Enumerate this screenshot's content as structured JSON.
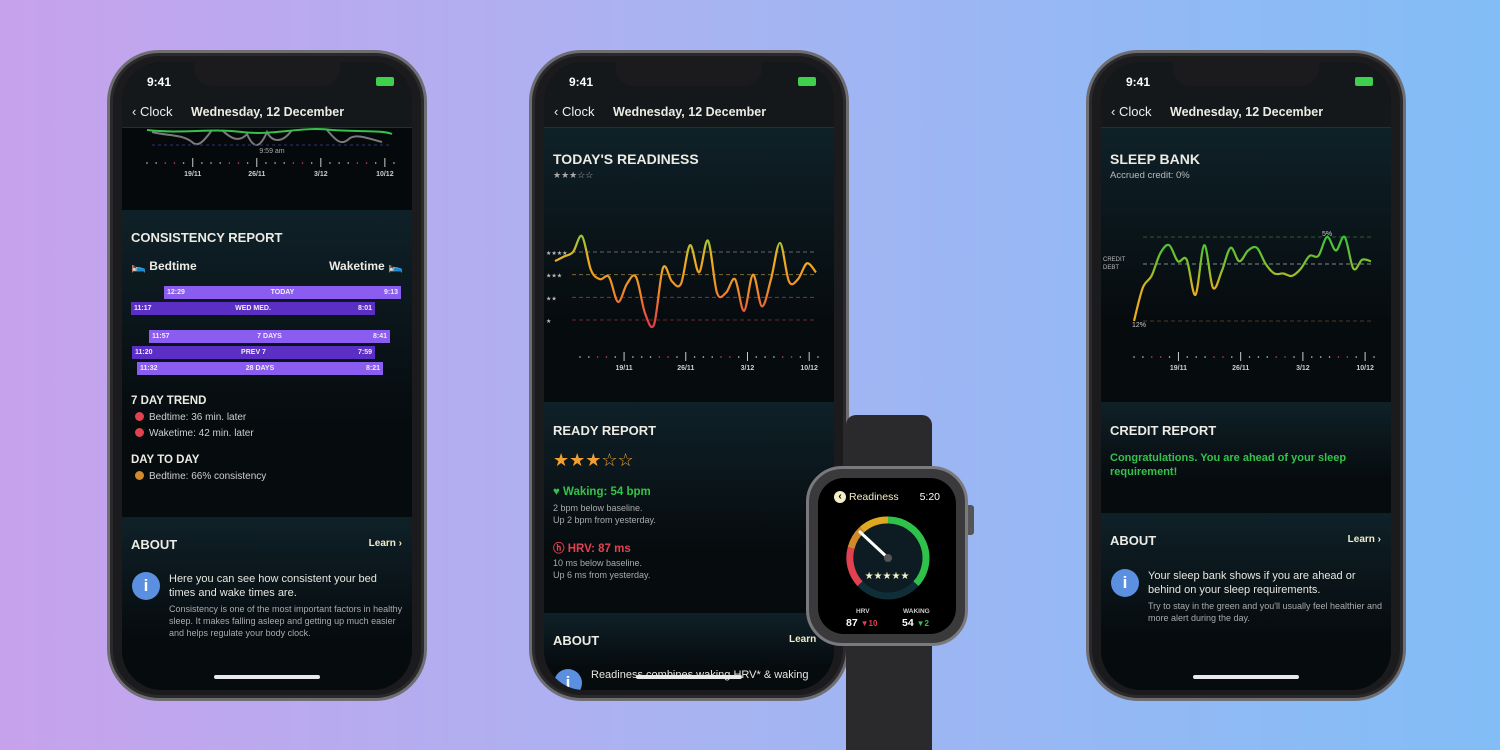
{
  "status": {
    "time": "9:41"
  },
  "nav": {
    "back": "Clock",
    "title": "Wednesday, 12 December"
  },
  "date_ticks": [
    "19/11",
    "26/11",
    "3/12",
    "10/12"
  ],
  "consistency": {
    "top_chart_label": "9:59 am",
    "title": "CONSISTENCY REPORT",
    "bedtime": "Bedtime",
    "waketime": "Waketime",
    "bars": [
      {
        "label": "TODAY",
        "start": "12:29",
        "end": "9:13",
        "color": "#8a5cf0"
      },
      {
        "label": "WED MED.",
        "start": "11:17",
        "end": "8:01",
        "color": "#5b2fc4"
      },
      {
        "label": "7 DAYS",
        "start": "11:57",
        "end": "8:41",
        "color": "#8a5cf0"
      },
      {
        "label": "PREV 7",
        "start": "11:20",
        "end": "7:59",
        "color": "#5b2fc4"
      },
      {
        "label": "28 DAYS",
        "start": "11:32",
        "end": "8:21",
        "color": "#8a5cf0"
      }
    ],
    "trend_title": "7 DAY TREND",
    "trend_items": [
      "Bedtime: 36 min. later",
      "Waketime: 42 min. later"
    ],
    "day_title": "DAY TO DAY",
    "day_items": [
      "Bedtime: 66% consistency"
    ],
    "about_title": "ABOUT",
    "learn": "Learn ›",
    "about_main": "Here you can see how consistent your bed times and wake times are.",
    "about_sub": "Consistency is one of the most important factors in healthy sleep. It makes falling asleep and getting up much easier and helps regulate your body clock."
  },
  "readiness": {
    "title": "TODAY'S READINESS",
    "stars": 3,
    "star_text": "★★★☆☆",
    "report_title": "READY REPORT",
    "waking": "♥ Waking: 54 bpm",
    "waking_l1": "2 bpm below baseline.",
    "waking_l2": "Up 2 bpm from yesterday.",
    "hrv": "ⓗ HRV: 87 ms",
    "hrv_l1": "10 ms below baseline.",
    "hrv_l2": "Up 6 ms from yesterday.",
    "about_title": "ABOUT",
    "learn": "Learn",
    "about_main": "Readiness combines waking HRV* & waking"
  },
  "sleep_bank": {
    "title": "SLEEP BANK",
    "subtitle": "Accrued credit: 0%",
    "credit_title": "CREDIT REPORT",
    "credit_text": "Congratulations. You are ahead of your sleep requirement!",
    "about_title": "ABOUT",
    "learn": "Learn ›",
    "about_main": "Your sleep bank shows if you are ahead or behind on your sleep requirements.",
    "about_sub": "Try to stay in the green and you'll usually feel healthier and more alert during the day."
  },
  "watch": {
    "title": "Readiness",
    "time": "5:20",
    "stars": "★★★★★",
    "stars_filled": 3,
    "hrv_label": "HRV",
    "hrv_value": "87",
    "hrv_delta": "▼10",
    "waking_label": "WAKING",
    "waking_value": "54",
    "waking_delta": "▼2"
  },
  "chart_data": [
    {
      "type": "line",
      "title": "TODAY'S READINESS",
      "x_ticks": [
        "19/11",
        "26/11",
        "3/12",
        "10/12"
      ],
      "y_ticks": [
        "★",
        "★★",
        "★★★",
        "★★★★"
      ],
      "ylim": [
        1,
        5
      ],
      "values": [
        3.6,
        3.8,
        4.0,
        4.7,
        3.2,
        2.8,
        2.9,
        1.8,
        2.6,
        2.9,
        1.3,
        0.8,
        3.3,
        2.7,
        2.6,
        4.3,
        3.1,
        4.5,
        2.2,
        2.2,
        2.8,
        1.4,
        3.0,
        1.6,
        2.8,
        4.4,
        2.7,
        2.8,
        3.5,
        3.1
      ]
    },
    {
      "type": "line",
      "title": "SLEEP BANK",
      "x_ticks": [
        "19/11",
        "26/11",
        "3/12",
        "10/12"
      ],
      "y_labels": [
        "CREDIT",
        "DEBT"
      ],
      "annotations": [
        "5%",
        "12%"
      ],
      "values": [
        -12,
        -5,
        -2.5,
        2,
        3.5,
        0.5,
        0.8,
        -6.5,
        3.5,
        -5,
        -1.5,
        3,
        0.5,
        2.5,
        3,
        0,
        -2,
        -2,
        -2.5,
        -1,
        1.5,
        1.5,
        5,
        2.5,
        5,
        -1,
        0.8,
        0.5
      ]
    }
  ]
}
